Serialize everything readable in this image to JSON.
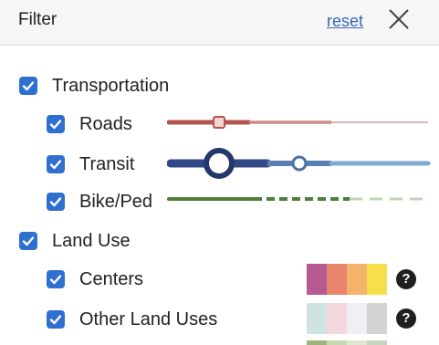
{
  "header": {
    "title": "Filter",
    "reset_label": "reset",
    "close_icon": "close-icon"
  },
  "groups": {
    "transportation": {
      "label": "Transportation",
      "checked": true,
      "items": {
        "roads": {
          "label": "Roads",
          "checked": true,
          "line_color": "#b5534f",
          "fade_color": "#d9a7a2"
        },
        "transit": {
          "label": "Transit",
          "checked": true,
          "line_color": "#2f4a86",
          "fade_color": "#7fa9d1"
        },
        "bike_ped": {
          "label": "Bike/Ped",
          "checked": true,
          "line_color": "#4f7d3a",
          "fade_color": "#bcd8b3"
        }
      }
    },
    "land_use": {
      "label": "Land Use",
      "checked": true,
      "items": {
        "centers": {
          "label": "Centers",
          "checked": true,
          "swatches": [
            "#b55b92",
            "#e8836c",
            "#f4b36a",
            "#f6e04a"
          ],
          "help_icon": "?"
        },
        "other": {
          "label": "Other Land Uses",
          "checked": true,
          "swatches": [
            "#cfe3e3",
            "#f3d9df",
            "#f1eff6",
            "#d3d3d3"
          ],
          "help_icon": "?"
        }
      }
    }
  },
  "colors": {
    "checkbox": "#2f6fd0",
    "link": "#3a66b8"
  }
}
